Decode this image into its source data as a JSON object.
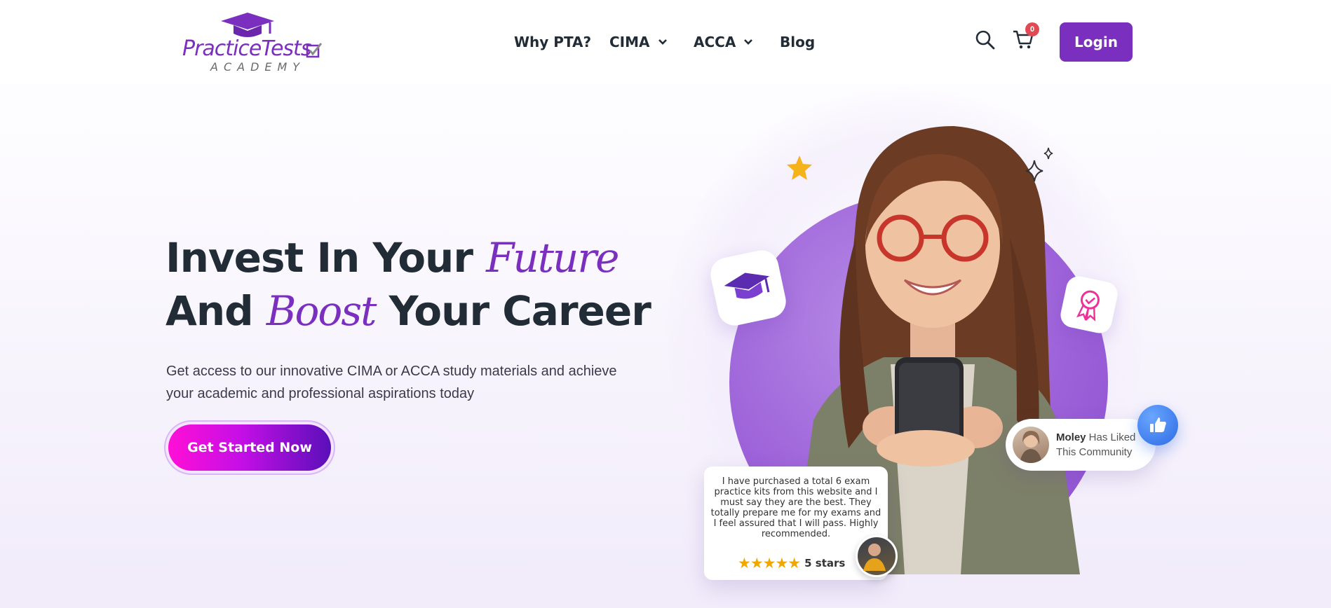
{
  "logo": {
    "brand": "PracticeTests",
    "sub": "ACADEMY",
    "brand_color": "#7a2fbf"
  },
  "nav": {
    "items": [
      {
        "label": "Why PTA?",
        "has_dropdown": false
      },
      {
        "label": "CIMA",
        "has_dropdown": true
      },
      {
        "label": "ACCA",
        "has_dropdown": true
      },
      {
        "label": "Blog",
        "has_dropdown": false
      }
    ],
    "search_icon": "search-icon",
    "cart_icon": "cart-icon",
    "cart_count": "0",
    "login_label": "Login"
  },
  "hero": {
    "headline_line1_a": "Invest In Your ",
    "headline_line1_accent": "Future",
    "headline_line2_a": "And ",
    "headline_line2_accent": "Boost",
    "headline_line2_b": " Your Career",
    "subtext": "Get access to our innovative CIMA or ACCA study materials and achieve your academic and professional aspirations today",
    "cta_label": "Get Started Now"
  },
  "social": {
    "like_name": "Moley",
    "like_rest_line1": " Has Liked",
    "like_line2": "This Community",
    "review_text": "I have purchased a total 6 exam practice kits from this website and I must say they are the best. They totally prepare me for my exams and I feel assured that I will pass. Highly recommended.",
    "review_stars": "★★★★★",
    "review_rating_label": "5 stars"
  },
  "colors": {
    "accent": "#7a2fbf",
    "text_dark": "#222c36",
    "cta_gradient_start": "#ff0fd6",
    "cta_gradient_end": "#5a0fb8",
    "badge_red": "#e04a55",
    "thumb_blue": "#2d6be4"
  }
}
